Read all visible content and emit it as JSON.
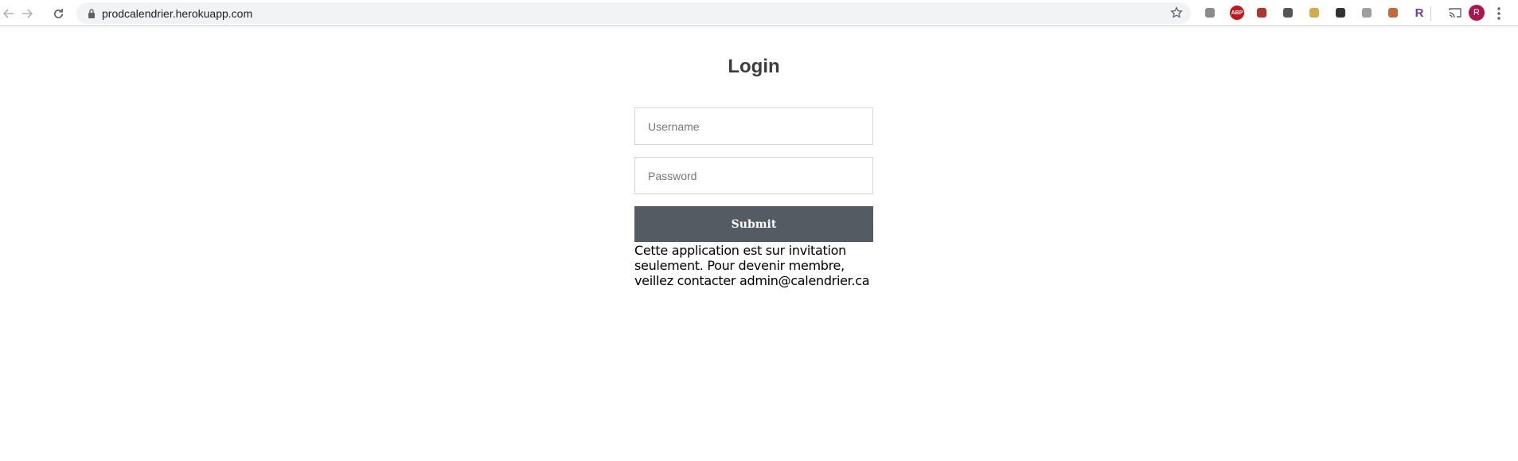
{
  "browser": {
    "url": "prodcalendrier.herokuapp.com",
    "profile_initial": "R",
    "extensions": [
      {
        "icon": "gear-extension-icon",
        "color": "#8a8a8a",
        "label": ""
      },
      {
        "icon": "adblock-icon",
        "color": "#c4161c",
        "label": "ABP"
      },
      {
        "icon": "pdf-icon",
        "color": "#b0352a",
        "label": ""
      },
      {
        "icon": "circle-extension-icon",
        "color": "#555555",
        "label": ""
      },
      {
        "icon": "image-extension-icon",
        "color": "#d9a84a",
        "label": ""
      },
      {
        "icon": "dots-extension-icon",
        "color": "#333333",
        "label": ""
      },
      {
        "icon": "font-extension-icon",
        "color": "#9e9e9e",
        "label": ""
      },
      {
        "icon": "picture-extension-icon",
        "color": "#c46a3a",
        "label": ""
      },
      {
        "icon": "r-extension-icon",
        "color": "#6a3ea8",
        "label": "R"
      }
    ]
  },
  "page": {
    "title": "Login",
    "username_placeholder": "Username",
    "password_placeholder": "Password",
    "submit_label": "Submit",
    "note": "Cette application est sur invitation seulement. Pour devenir membre, veillez contacter admin@calendrier.ca"
  },
  "colors": {
    "submit_bg": "#545b62",
    "title_color": "#3d3d3d"
  }
}
